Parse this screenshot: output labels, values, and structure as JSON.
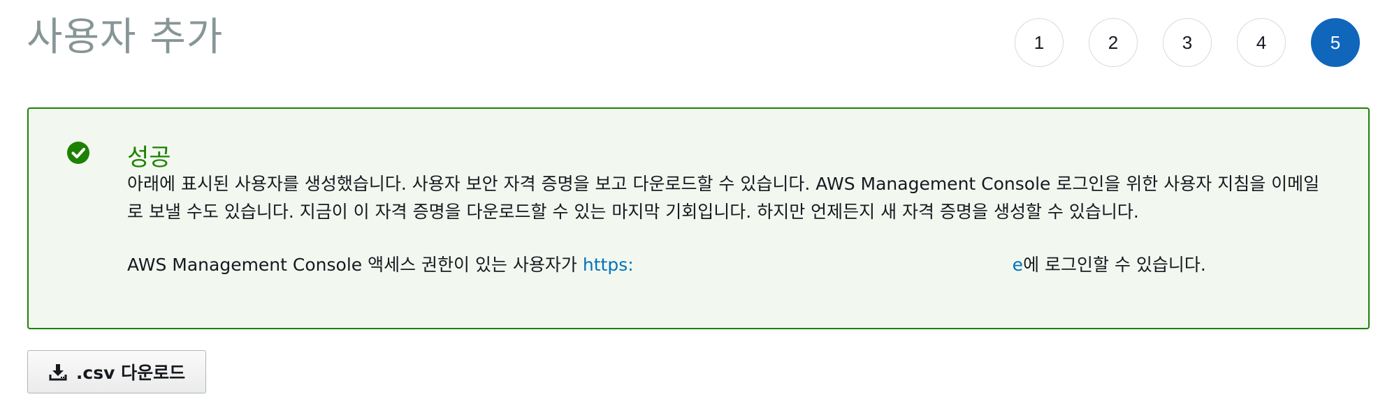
{
  "page_title": "사용자 추가",
  "steps": [
    {
      "label": "1",
      "active": false
    },
    {
      "label": "2",
      "active": false
    },
    {
      "label": "3",
      "active": false
    },
    {
      "label": "4",
      "active": false
    },
    {
      "label": "5",
      "active": true
    }
  ],
  "alert": {
    "type": "success",
    "icon": "check-circle-icon",
    "title": "성공",
    "body": "아래에 표시된 사용자를 생성했습니다. 사용자 보안 자격 증명을 보고 다운로드할 수 있습니다. AWS Management Console 로그인을 위한 사용자 지침을 이메일로 보낼 수도 있습니다. 지금이 이 자격 증명을 다운로드할 수 있는 마지막 기회입니다. 하지만 언제든지 새 자격 증명을 생성할 수 있습니다.",
    "console_prefix": "AWS Management Console 액세스 권한이 있는 사용자가 ",
    "console_link_start": "https:",
    "console_link_end": "e",
    "console_suffix": "에 로그인할 수 있습니다."
  },
  "download_button": {
    "icon": "download-icon",
    "label": ".csv 다운로드"
  },
  "colors": {
    "success": "#1d8102",
    "success_bg": "#f2f8f0",
    "active_step": "#1066bb",
    "link": "#0073bb"
  }
}
